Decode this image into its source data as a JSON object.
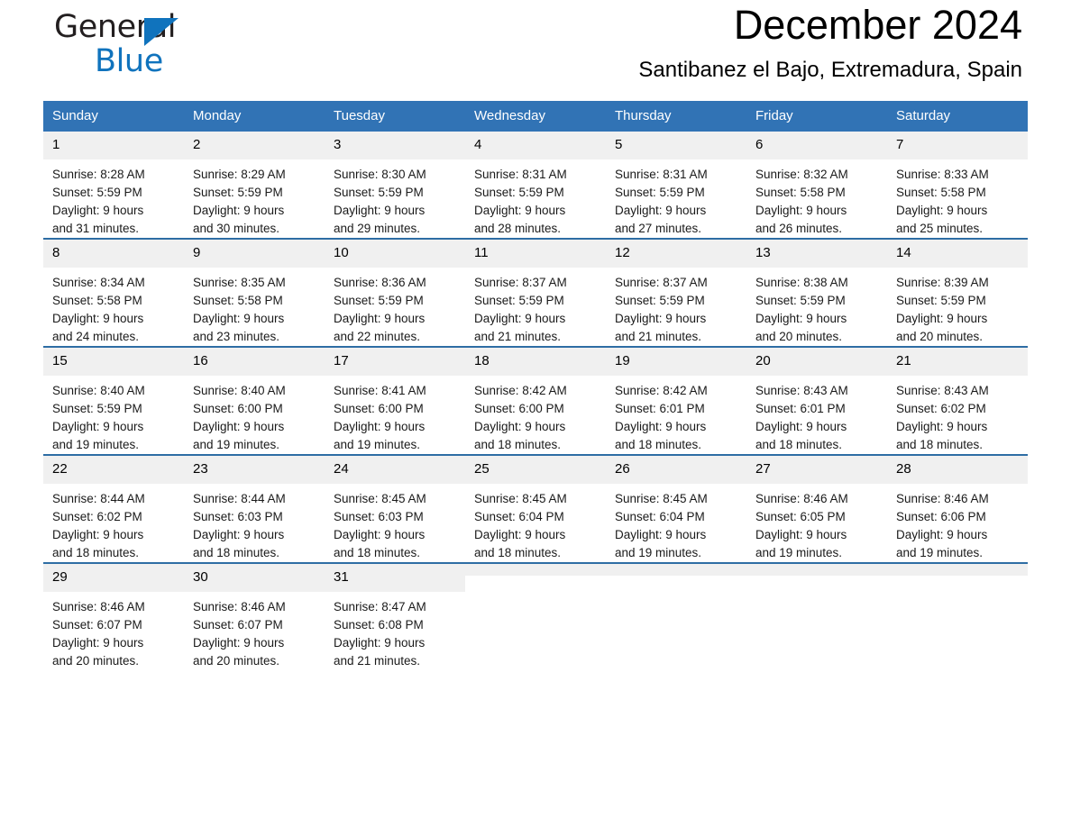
{
  "brand": {
    "name_part1": "General",
    "name_part2": "Blue",
    "triangle_color": "#1073bd"
  },
  "header": {
    "title": "December 2024",
    "location": "Santibanez el Bajo, Extremadura, Spain"
  },
  "theme": {
    "header_blue": "#3173b5",
    "row_divider_blue": "#2e6da4",
    "daynum_band": "#f0f0f0"
  },
  "weekday_headers": [
    "Sunday",
    "Monday",
    "Tuesday",
    "Wednesday",
    "Thursday",
    "Friday",
    "Saturday"
  ],
  "labels": {
    "sunrise_prefix": "Sunrise: ",
    "sunset_prefix": "Sunset: ",
    "daylight_prefix": "Daylight: "
  },
  "weeks": [
    [
      {
        "day": "1",
        "sunrise": "Sunrise: 8:28 AM",
        "sunset": "Sunset: 5:59 PM",
        "daylight1": "Daylight: 9 hours",
        "daylight2": "and 31 minutes."
      },
      {
        "day": "2",
        "sunrise": "Sunrise: 8:29 AM",
        "sunset": "Sunset: 5:59 PM",
        "daylight1": "Daylight: 9 hours",
        "daylight2": "and 30 minutes."
      },
      {
        "day": "3",
        "sunrise": "Sunrise: 8:30 AM",
        "sunset": "Sunset: 5:59 PM",
        "daylight1": "Daylight: 9 hours",
        "daylight2": "and 29 minutes."
      },
      {
        "day": "4",
        "sunrise": "Sunrise: 8:31 AM",
        "sunset": "Sunset: 5:59 PM",
        "daylight1": "Daylight: 9 hours",
        "daylight2": "and 28 minutes."
      },
      {
        "day": "5",
        "sunrise": "Sunrise: 8:31 AM",
        "sunset": "Sunset: 5:59 PM",
        "daylight1": "Daylight: 9 hours",
        "daylight2": "and 27 minutes."
      },
      {
        "day": "6",
        "sunrise": "Sunrise: 8:32 AM",
        "sunset": "Sunset: 5:58 PM",
        "daylight1": "Daylight: 9 hours",
        "daylight2": "and 26 minutes."
      },
      {
        "day": "7",
        "sunrise": "Sunrise: 8:33 AM",
        "sunset": "Sunset: 5:58 PM",
        "daylight1": "Daylight: 9 hours",
        "daylight2": "and 25 minutes."
      }
    ],
    [
      {
        "day": "8",
        "sunrise": "Sunrise: 8:34 AM",
        "sunset": "Sunset: 5:58 PM",
        "daylight1": "Daylight: 9 hours",
        "daylight2": "and 24 minutes."
      },
      {
        "day": "9",
        "sunrise": "Sunrise: 8:35 AM",
        "sunset": "Sunset: 5:58 PM",
        "daylight1": "Daylight: 9 hours",
        "daylight2": "and 23 minutes."
      },
      {
        "day": "10",
        "sunrise": "Sunrise: 8:36 AM",
        "sunset": "Sunset: 5:59 PM",
        "daylight1": "Daylight: 9 hours",
        "daylight2": "and 22 minutes."
      },
      {
        "day": "11",
        "sunrise": "Sunrise: 8:37 AM",
        "sunset": "Sunset: 5:59 PM",
        "daylight1": "Daylight: 9 hours",
        "daylight2": "and 21 minutes."
      },
      {
        "day": "12",
        "sunrise": "Sunrise: 8:37 AM",
        "sunset": "Sunset: 5:59 PM",
        "daylight1": "Daylight: 9 hours",
        "daylight2": "and 21 minutes."
      },
      {
        "day": "13",
        "sunrise": "Sunrise: 8:38 AM",
        "sunset": "Sunset: 5:59 PM",
        "daylight1": "Daylight: 9 hours",
        "daylight2": "and 20 minutes."
      },
      {
        "day": "14",
        "sunrise": "Sunrise: 8:39 AM",
        "sunset": "Sunset: 5:59 PM",
        "daylight1": "Daylight: 9 hours",
        "daylight2": "and 20 minutes."
      }
    ],
    [
      {
        "day": "15",
        "sunrise": "Sunrise: 8:40 AM",
        "sunset": "Sunset: 5:59 PM",
        "daylight1": "Daylight: 9 hours",
        "daylight2": "and 19 minutes."
      },
      {
        "day": "16",
        "sunrise": "Sunrise: 8:40 AM",
        "sunset": "Sunset: 6:00 PM",
        "daylight1": "Daylight: 9 hours",
        "daylight2": "and 19 minutes."
      },
      {
        "day": "17",
        "sunrise": "Sunrise: 8:41 AM",
        "sunset": "Sunset: 6:00 PM",
        "daylight1": "Daylight: 9 hours",
        "daylight2": "and 19 minutes."
      },
      {
        "day": "18",
        "sunrise": "Sunrise: 8:42 AM",
        "sunset": "Sunset: 6:00 PM",
        "daylight1": "Daylight: 9 hours",
        "daylight2": "and 18 minutes."
      },
      {
        "day": "19",
        "sunrise": "Sunrise: 8:42 AM",
        "sunset": "Sunset: 6:01 PM",
        "daylight1": "Daylight: 9 hours",
        "daylight2": "and 18 minutes."
      },
      {
        "day": "20",
        "sunrise": "Sunrise: 8:43 AM",
        "sunset": "Sunset: 6:01 PM",
        "daylight1": "Daylight: 9 hours",
        "daylight2": "and 18 minutes."
      },
      {
        "day": "21",
        "sunrise": "Sunrise: 8:43 AM",
        "sunset": "Sunset: 6:02 PM",
        "daylight1": "Daylight: 9 hours",
        "daylight2": "and 18 minutes."
      }
    ],
    [
      {
        "day": "22",
        "sunrise": "Sunrise: 8:44 AM",
        "sunset": "Sunset: 6:02 PM",
        "daylight1": "Daylight: 9 hours",
        "daylight2": "and 18 minutes."
      },
      {
        "day": "23",
        "sunrise": "Sunrise: 8:44 AM",
        "sunset": "Sunset: 6:03 PM",
        "daylight1": "Daylight: 9 hours",
        "daylight2": "and 18 minutes."
      },
      {
        "day": "24",
        "sunrise": "Sunrise: 8:45 AM",
        "sunset": "Sunset: 6:03 PM",
        "daylight1": "Daylight: 9 hours",
        "daylight2": "and 18 minutes."
      },
      {
        "day": "25",
        "sunrise": "Sunrise: 8:45 AM",
        "sunset": "Sunset: 6:04 PM",
        "daylight1": "Daylight: 9 hours",
        "daylight2": "and 18 minutes."
      },
      {
        "day": "26",
        "sunrise": "Sunrise: 8:45 AM",
        "sunset": "Sunset: 6:04 PM",
        "daylight1": "Daylight: 9 hours",
        "daylight2": "and 19 minutes."
      },
      {
        "day": "27",
        "sunrise": "Sunrise: 8:46 AM",
        "sunset": "Sunset: 6:05 PM",
        "daylight1": "Daylight: 9 hours",
        "daylight2": "and 19 minutes."
      },
      {
        "day": "28",
        "sunrise": "Sunrise: 8:46 AM",
        "sunset": "Sunset: 6:06 PM",
        "daylight1": "Daylight: 9 hours",
        "daylight2": "and 19 minutes."
      }
    ],
    [
      {
        "day": "29",
        "sunrise": "Sunrise: 8:46 AM",
        "sunset": "Sunset: 6:07 PM",
        "daylight1": "Daylight: 9 hours",
        "daylight2": "and 20 minutes."
      },
      {
        "day": "30",
        "sunrise": "Sunrise: 8:46 AM",
        "sunset": "Sunset: 6:07 PM",
        "daylight1": "Daylight: 9 hours",
        "daylight2": "and 20 minutes."
      },
      {
        "day": "31",
        "sunrise": "Sunrise: 8:47 AM",
        "sunset": "Sunset: 6:08 PM",
        "daylight1": "Daylight: 9 hours",
        "daylight2": "and 21 minutes."
      },
      {
        "day": "",
        "sunrise": "",
        "sunset": "",
        "daylight1": "",
        "daylight2": ""
      },
      {
        "day": "",
        "sunrise": "",
        "sunset": "",
        "daylight1": "",
        "daylight2": ""
      },
      {
        "day": "",
        "sunrise": "",
        "sunset": "",
        "daylight1": "",
        "daylight2": ""
      },
      {
        "day": "",
        "sunrise": "",
        "sunset": "",
        "daylight1": "",
        "daylight2": ""
      }
    ]
  ]
}
